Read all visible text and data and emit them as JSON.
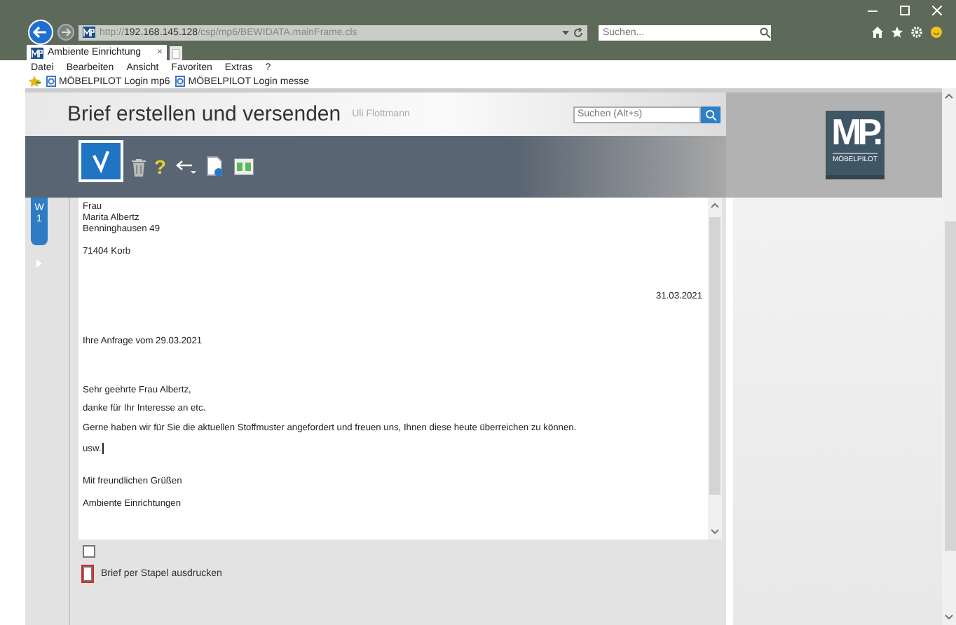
{
  "browser": {
    "address_scheme": "http://",
    "address_host": "192.168.145.128",
    "address_path": "/csp/mp6/BEWIDATA.mainFrame.cls",
    "search_placeholder": "Suchen...",
    "tabs": [
      {
        "label": "Ambiente Einrichtung",
        "close": "×",
        "selected": true
      }
    ],
    "menu": [
      "Datei",
      "Bearbeiten",
      "Ansicht",
      "Favoriten",
      "Extras",
      "?"
    ],
    "favorites": [
      "MÖBELPILOT Login mp6",
      "MÖBELPILOT Login messe"
    ]
  },
  "app": {
    "title": "Brief erstellen und versenden",
    "user": "Uli Flottmann",
    "search_placeholder": "Suchen (Alt+s)",
    "logo": "MP.",
    "logo_caption": "MÖBELPILOT",
    "toolbar": [
      {
        "kind": "confirm",
        "selected": true
      },
      {
        "kind": "trash",
        "selected": false
      },
      {
        "kind": "help",
        "text": "?",
        "selected": false
      },
      {
        "kind": "back",
        "selected": false
      },
      {
        "kind": "preview",
        "selected": false
      },
      {
        "kind": "book",
        "selected": false
      }
    ],
    "side_tabs": [
      {
        "label": "W 1",
        "selected": true
      }
    ]
  },
  "letter": {
    "blocks": [
      {
        "kind": "address",
        "lines": [
          "Frau",
          "Marita Albertz",
          "Benninghausen 49"
        ]
      },
      {
        "kind": "address",
        "lines": [
          "71404 Korb"
        ]
      },
      {
        "kind": "date",
        "lines": [
          "31.03.2021"
        ]
      },
      {
        "kind": "subject",
        "lines": [
          "Ihre Anfrage vom 29.03.2021"
        ]
      },
      {
        "kind": "salutation",
        "lines": [
          "Sehr geehrte Frau Albertz,"
        ]
      },
      {
        "kind": "body",
        "lines": [
          "danke für Ihr Interesse an etc.",
          "Gerne haben wir für Sie die aktuellen Stoffmuster angefordert und freuen uns, Ihnen diese heute überreichen zu können.",
          "usw."
        ],
        "caret": true
      },
      {
        "kind": "closing",
        "lines": [
          "Mit freundlichen Grüßen",
          "Ambiente Einrichtungen"
        ]
      }
    ]
  },
  "options": [
    {
      "checked": false,
      "focused": false
    },
    {
      "label": "Brief per Stapel ausdrucken",
      "checked": false,
      "focused": true
    }
  ]
}
